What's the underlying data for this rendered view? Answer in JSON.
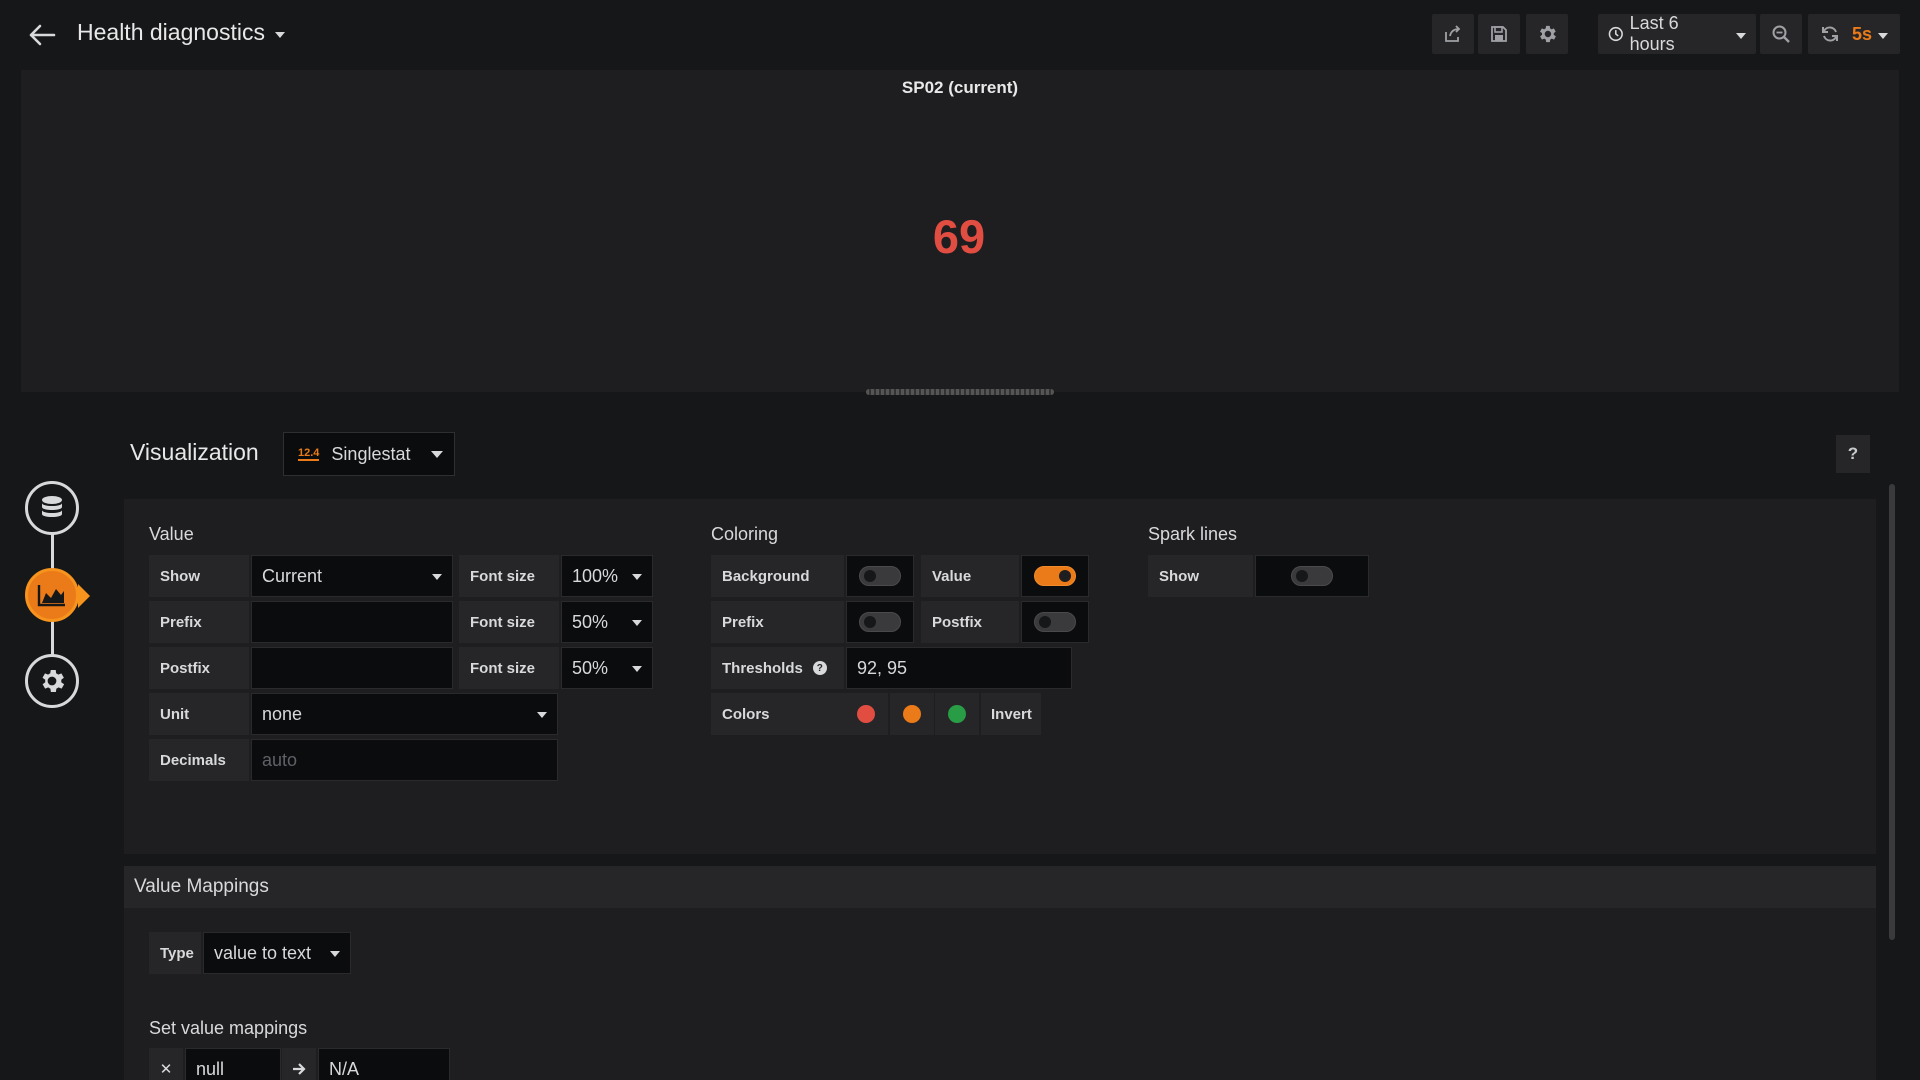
{
  "navbar": {
    "title": "Health diagnostics",
    "actions": [
      {
        "icon": "share-icon"
      },
      {
        "icon": "save-icon"
      },
      {
        "icon": "gear-icon"
      }
    ],
    "time_range": "Last 6 hours",
    "refresh_rate": "5s"
  },
  "panel": {
    "title": "SP02 (current)",
    "value": "69",
    "value_color": "#e24d42"
  },
  "rail": {
    "items": [
      {
        "icon": "database-icon",
        "active": false
      },
      {
        "icon": "visualization-icon",
        "active": true
      },
      {
        "icon": "general-settings-icon",
        "active": false
      }
    ]
  },
  "editor": {
    "title": "Visualization",
    "picker": {
      "badge": "12.4",
      "label": "Singlestat"
    },
    "help": "?"
  },
  "value_section": {
    "title": "Value",
    "show_label": "Show",
    "show_value": "Current",
    "font_size_label": "Font size",
    "font_size_value": "100%",
    "prefix_label": "Prefix",
    "prefix_value": "",
    "prefix_font_size_value": "50%",
    "postfix_label": "Postfix",
    "postfix_value": "",
    "postfix_font_size_value": "50%",
    "unit_label": "Unit",
    "unit_value": "none",
    "decimals_label": "Decimals",
    "decimals_placeholder": "auto"
  },
  "coloring_section": {
    "title": "Coloring",
    "background_label": "Background",
    "background_on": false,
    "value_label": "Value",
    "value_on": true,
    "prefix_label": "Prefix",
    "prefix_on": false,
    "postfix_label": "Postfix",
    "postfix_on": false,
    "thresholds_label": "Thresholds",
    "thresholds_value": "92, 95",
    "colors_label": "Colors",
    "colors": [
      "#e24d42",
      "#eb7b18",
      "#299c46"
    ],
    "invert_label": "Invert"
  },
  "sparklines_section": {
    "title": "Spark lines",
    "show_label": "Show",
    "show_on": false
  },
  "mappings": {
    "title": "Value Mappings",
    "type_label": "Type",
    "type_value": "value to text",
    "set_title": "Set value mappings",
    "rows": [
      {
        "from": "null",
        "to": "N/A"
      }
    ]
  }
}
